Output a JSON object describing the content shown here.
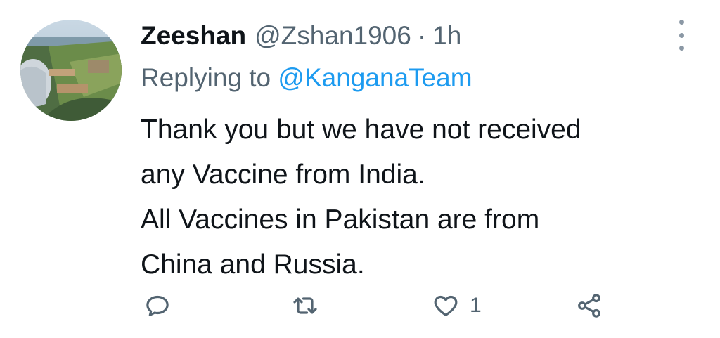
{
  "tweet": {
    "display_name": "Zeeshan",
    "handle": "@Zshan1906",
    "separator": "·",
    "time": "1h",
    "replying_prefix": "Replying to",
    "replying_to": "@KanganaTeam",
    "body_lines": [
      "Thank you but we have not received",
      "any Vaccine from India.",
      "All Vaccines in Pakistan are from",
      "China and Russia."
    ]
  },
  "actions": {
    "reply_icon": "comment-icon",
    "retweet_icon": "retweet-icon",
    "like_icon": "heart-icon",
    "like_count": "1",
    "share_icon": "share-icon",
    "more_icon": "more-vertical-icon"
  },
  "colors": {
    "text": "#0f1419",
    "secondary": "#536471",
    "link": "#1d9bf0",
    "icon": "#536471"
  }
}
